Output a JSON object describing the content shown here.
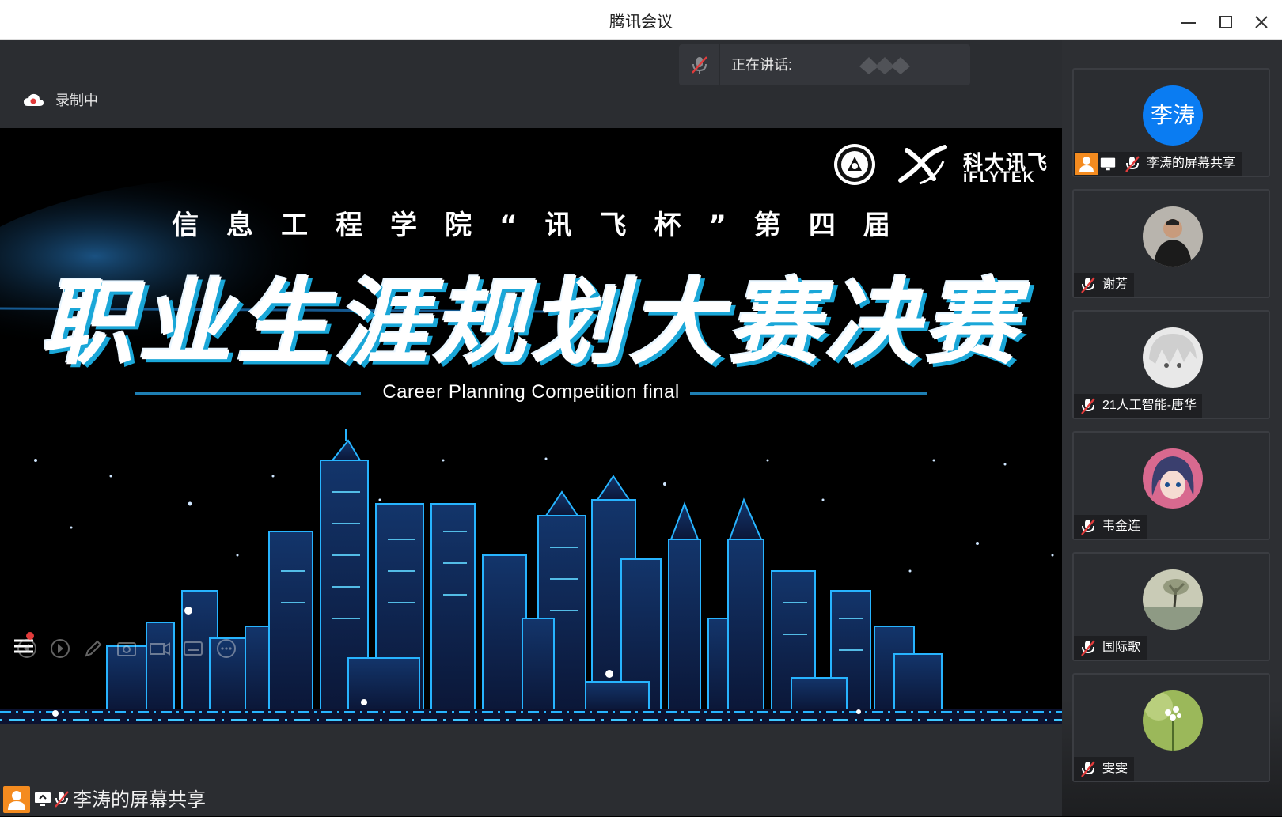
{
  "window": {
    "title": "腾讯会议",
    "controls": [
      "minimize",
      "maximize",
      "close"
    ]
  },
  "speaking": {
    "label": "正在讲话:",
    "mic_state": "muted"
  },
  "recording": {
    "label": "录制中"
  },
  "slide": {
    "subtitle": "信息工程学院“讯飞杯”第四届",
    "title": "职业生涯规划大赛决赛",
    "english_title": "Career Planning Competition final",
    "brand_cn": "科大讯飞",
    "brand_en": "iFLYTEK"
  },
  "share_tag": {
    "label": "李涛的屏幕共享"
  },
  "participants": [
    {
      "name": "李涛的屏幕共享",
      "avatar_text": "李涛",
      "avatar_type": "text",
      "host": true,
      "sharing": true,
      "muted": true
    },
    {
      "name": "谢芳",
      "avatar_type": "photo-person",
      "muted": true
    },
    {
      "name": "21人工智能-唐华",
      "avatar_type": "photo-anime-gray",
      "muted": true
    },
    {
      "name": "韦金连",
      "avatar_type": "photo-anime-girl",
      "muted": true
    },
    {
      "name": "国际歌",
      "avatar_type": "photo-landscape",
      "muted": true
    },
    {
      "name": "雯雯",
      "avatar_type": "photo-flower",
      "muted": true
    }
  ],
  "colors": {
    "titlebar_bg": "#ffffff",
    "stage_bg": "#2b2d31",
    "accent_blue": "#0a7cf2",
    "host_orange": "#f48b1f",
    "mute_red": "#e23b3b",
    "slide_cyan": "#1aa7d8"
  }
}
